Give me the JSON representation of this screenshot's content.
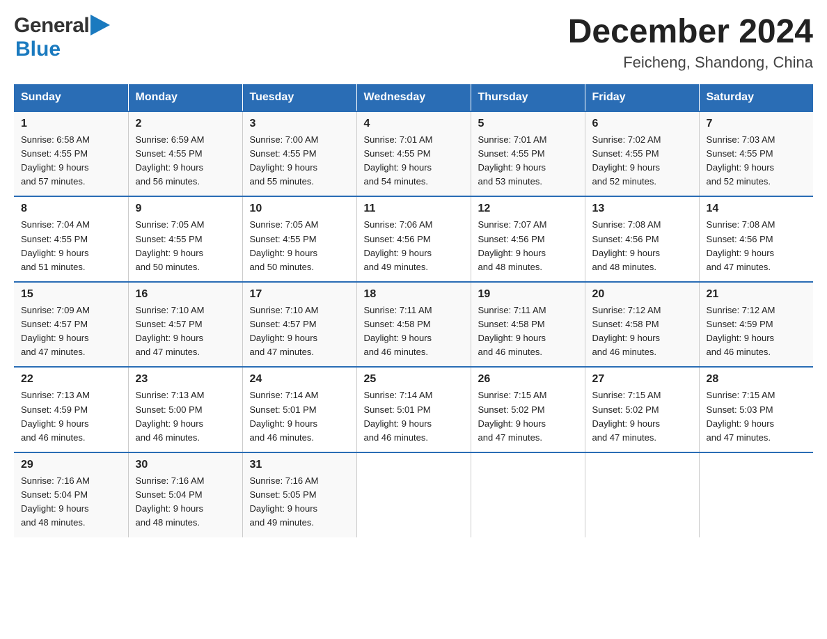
{
  "logo": {
    "line1": "General",
    "arrow": "▶",
    "line2": "Blue"
  },
  "title": "December 2024",
  "location": "Feicheng, Shandong, China",
  "days_of_week": [
    "Sunday",
    "Monday",
    "Tuesday",
    "Wednesday",
    "Thursday",
    "Friday",
    "Saturday"
  ],
  "weeks": [
    [
      {
        "day": "1",
        "sunrise": "6:58 AM",
        "sunset": "4:55 PM",
        "daylight": "9 hours and 57 minutes."
      },
      {
        "day": "2",
        "sunrise": "6:59 AM",
        "sunset": "4:55 PM",
        "daylight": "9 hours and 56 minutes."
      },
      {
        "day": "3",
        "sunrise": "7:00 AM",
        "sunset": "4:55 PM",
        "daylight": "9 hours and 55 minutes."
      },
      {
        "day": "4",
        "sunrise": "7:01 AM",
        "sunset": "4:55 PM",
        "daylight": "9 hours and 54 minutes."
      },
      {
        "day": "5",
        "sunrise": "7:01 AM",
        "sunset": "4:55 PM",
        "daylight": "9 hours and 53 minutes."
      },
      {
        "day": "6",
        "sunrise": "7:02 AM",
        "sunset": "4:55 PM",
        "daylight": "9 hours and 52 minutes."
      },
      {
        "day": "7",
        "sunrise": "7:03 AM",
        "sunset": "4:55 PM",
        "daylight": "9 hours and 52 minutes."
      }
    ],
    [
      {
        "day": "8",
        "sunrise": "7:04 AM",
        "sunset": "4:55 PM",
        "daylight": "9 hours and 51 minutes."
      },
      {
        "day": "9",
        "sunrise": "7:05 AM",
        "sunset": "4:55 PM",
        "daylight": "9 hours and 50 minutes."
      },
      {
        "day": "10",
        "sunrise": "7:05 AM",
        "sunset": "4:55 PM",
        "daylight": "9 hours and 50 minutes."
      },
      {
        "day": "11",
        "sunrise": "7:06 AM",
        "sunset": "4:56 PM",
        "daylight": "9 hours and 49 minutes."
      },
      {
        "day": "12",
        "sunrise": "7:07 AM",
        "sunset": "4:56 PM",
        "daylight": "9 hours and 48 minutes."
      },
      {
        "day": "13",
        "sunrise": "7:08 AM",
        "sunset": "4:56 PM",
        "daylight": "9 hours and 48 minutes."
      },
      {
        "day": "14",
        "sunrise": "7:08 AM",
        "sunset": "4:56 PM",
        "daylight": "9 hours and 47 minutes."
      }
    ],
    [
      {
        "day": "15",
        "sunrise": "7:09 AM",
        "sunset": "4:57 PM",
        "daylight": "9 hours and 47 minutes."
      },
      {
        "day": "16",
        "sunrise": "7:10 AM",
        "sunset": "4:57 PM",
        "daylight": "9 hours and 47 minutes."
      },
      {
        "day": "17",
        "sunrise": "7:10 AM",
        "sunset": "4:57 PM",
        "daylight": "9 hours and 47 minutes."
      },
      {
        "day": "18",
        "sunrise": "7:11 AM",
        "sunset": "4:58 PM",
        "daylight": "9 hours and 46 minutes."
      },
      {
        "day": "19",
        "sunrise": "7:11 AM",
        "sunset": "4:58 PM",
        "daylight": "9 hours and 46 minutes."
      },
      {
        "day": "20",
        "sunrise": "7:12 AM",
        "sunset": "4:58 PM",
        "daylight": "9 hours and 46 minutes."
      },
      {
        "day": "21",
        "sunrise": "7:12 AM",
        "sunset": "4:59 PM",
        "daylight": "9 hours and 46 minutes."
      }
    ],
    [
      {
        "day": "22",
        "sunrise": "7:13 AM",
        "sunset": "4:59 PM",
        "daylight": "9 hours and 46 minutes."
      },
      {
        "day": "23",
        "sunrise": "7:13 AM",
        "sunset": "5:00 PM",
        "daylight": "9 hours and 46 minutes."
      },
      {
        "day": "24",
        "sunrise": "7:14 AM",
        "sunset": "5:01 PM",
        "daylight": "9 hours and 46 minutes."
      },
      {
        "day": "25",
        "sunrise": "7:14 AM",
        "sunset": "5:01 PM",
        "daylight": "9 hours and 46 minutes."
      },
      {
        "day": "26",
        "sunrise": "7:15 AM",
        "sunset": "5:02 PM",
        "daylight": "9 hours and 47 minutes."
      },
      {
        "day": "27",
        "sunrise": "7:15 AM",
        "sunset": "5:02 PM",
        "daylight": "9 hours and 47 minutes."
      },
      {
        "day": "28",
        "sunrise": "7:15 AM",
        "sunset": "5:03 PM",
        "daylight": "9 hours and 47 minutes."
      }
    ],
    [
      {
        "day": "29",
        "sunrise": "7:16 AM",
        "sunset": "5:04 PM",
        "daylight": "9 hours and 48 minutes."
      },
      {
        "day": "30",
        "sunrise": "7:16 AM",
        "sunset": "5:04 PM",
        "daylight": "9 hours and 48 minutes."
      },
      {
        "day": "31",
        "sunrise": "7:16 AM",
        "sunset": "5:05 PM",
        "daylight": "9 hours and 49 minutes."
      },
      null,
      null,
      null,
      null
    ]
  ],
  "labels": {
    "sunrise": "Sunrise:",
    "sunset": "Sunset:",
    "daylight": "Daylight:"
  }
}
